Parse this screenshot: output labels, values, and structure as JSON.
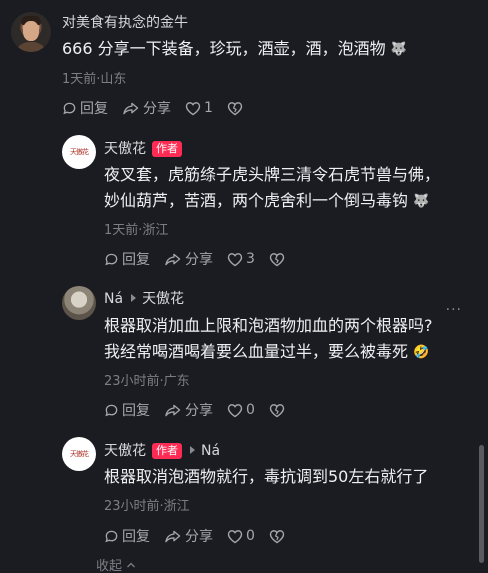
{
  "comments": [
    {
      "username": "对美食有执念的金牛",
      "text": "666 分享一下装备，珍玩，酒壶，酒，泡酒物",
      "meta": "1天前·山东",
      "reply_label": "回复",
      "share_label": "分享",
      "like_count": "1"
    },
    {
      "username": "天傲花",
      "badge": "作者",
      "line1": "夜叉套，虎筋绦子虎头牌三清令石虎节兽与佛，",
      "line2": "妙仙葫芦，苦酒，两个虎舍利一个倒马毒钩",
      "meta": "1天前·浙江",
      "reply_label": "回复",
      "share_label": "分享",
      "like_count": "3"
    },
    {
      "username": "Ná",
      "reply_to": "天傲花",
      "line1": "根器取消加血上限和泡酒物加血的两个根器吗?",
      "line2": "我经常喝酒喝着要么血量过半，要么被毒死",
      "meta": "23小时前·广东",
      "reply_label": "回复",
      "share_label": "分享",
      "like_count": "0"
    },
    {
      "username": "天傲花",
      "badge": "作者",
      "reply_to": "Ná",
      "text": "根器取消泡酒物就行，毒抗调到50左右就行了",
      "meta": "23小时前·浙江",
      "reply_label": "回复",
      "share_label": "分享",
      "like_count": "0"
    }
  ],
  "avatar_signature": "天傲花",
  "more_label": "···",
  "collapse_label": "收起",
  "colors": {
    "background": "#1b1c22",
    "badge": "#fe2c55",
    "meta": "#7d7e85"
  }
}
